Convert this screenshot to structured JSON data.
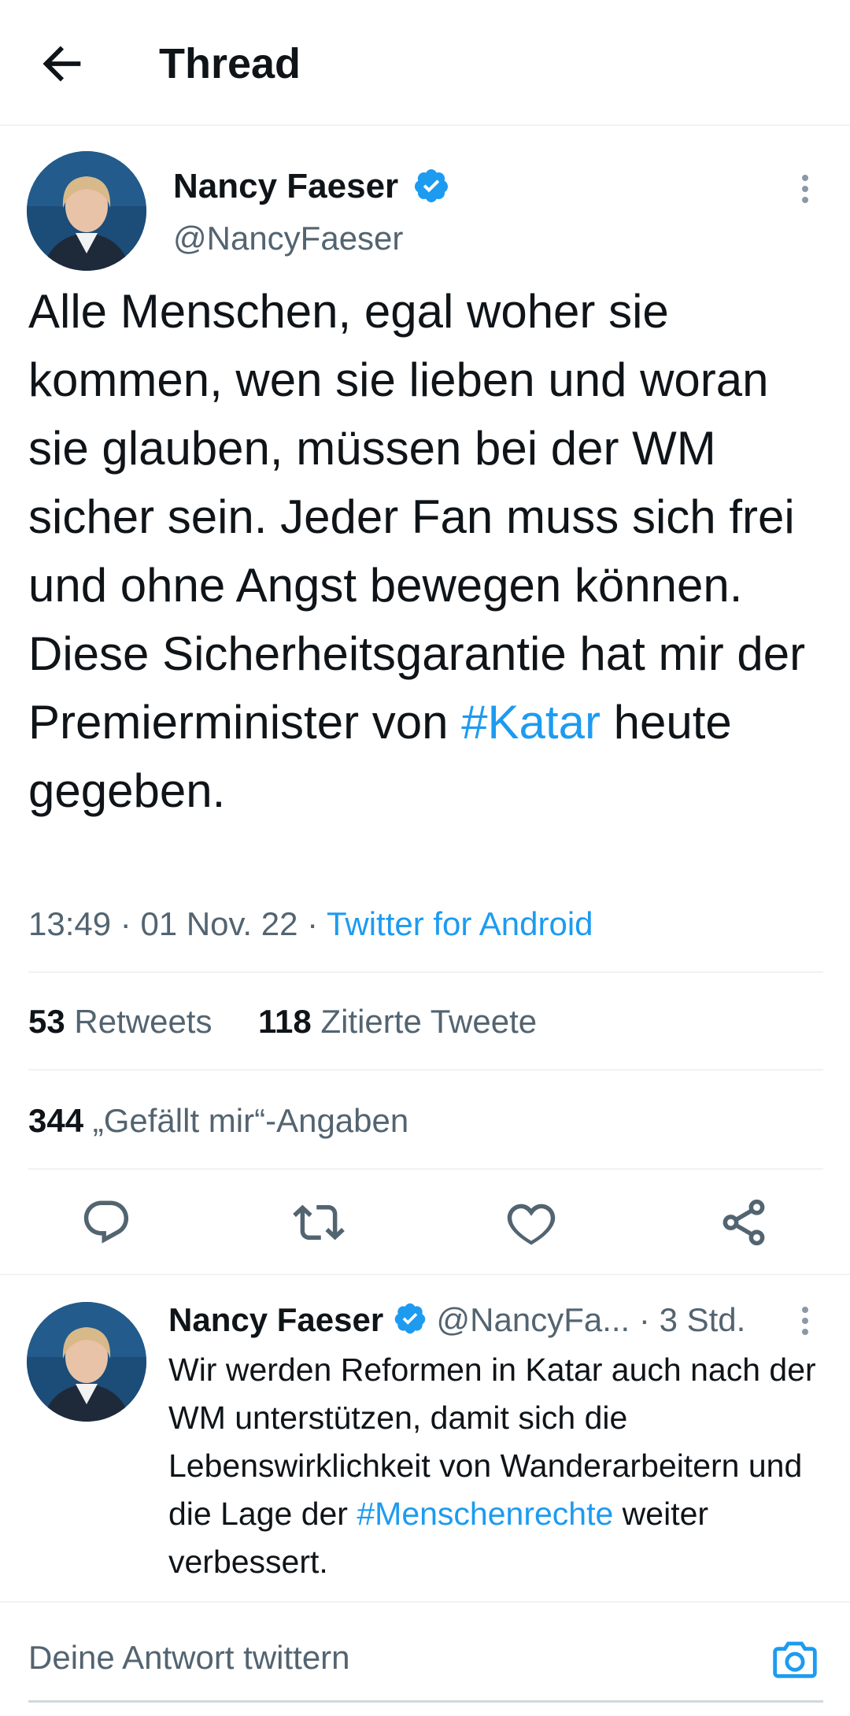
{
  "header": {
    "title": "Thread",
    "back_icon": "arrow-left-icon"
  },
  "tweet": {
    "author_name": "Nancy Faeser",
    "author_handle": "@NancyFaeser",
    "verified": true,
    "text_before_tag": "Alle Menschen, egal woher sie kommen, wen sie lieben und woran sie glauben, müssen bei der WM sicher sein. Jeder Fan muss sich frei und ohne Angst bewegen können. Diese Sicherheitsgarantie hat mir der Premierminister von ",
    "hashtag": "#Katar",
    "text_after_tag": " heute gegeben.",
    "time": "13:49",
    "date": "01 Nov. 22",
    "source": "Twitter for Android",
    "retweets_count": "53",
    "retweets_label": "Retweets",
    "quotes_count": "118",
    "quotes_label": "Zitierte Tweete",
    "likes_count": "344",
    "likes_label": "„Gefällt mir“-Angaben"
  },
  "reply": {
    "author_name": "Nancy Faeser",
    "author_handle": "@NancyFa...",
    "age": "3 Std.",
    "text_before_tag": "Wir werden Reformen in Katar auch nach der WM unterstützen, damit sich die Lebenswirklichkeit von Wanderarbeitern und die Lage der ",
    "hashtag": "#Menschenrechte",
    "text_after_tag": " weiter verbessert."
  },
  "composer": {
    "placeholder": "Deine Antwort twittern",
    "camera_icon": "camera-icon"
  },
  "colors": {
    "accent": "#1d9bf0",
    "text": "#0f1419",
    "secondary": "#536471"
  }
}
